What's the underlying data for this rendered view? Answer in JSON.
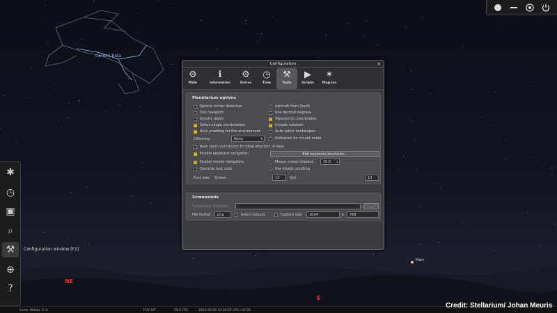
{
  "sky": {
    "constellation_label": "Gemini Beta",
    "planet_label": "Mars",
    "cardinals": {
      "ne": "NE",
      "e": "E"
    }
  },
  "tooltip": "Configuration window  [F2]",
  "credit": "Credit: Stellarium/ Johan Meuris",
  "statusbar": {
    "location": "Earth, Wikitti, 0 m",
    "fov": "FOV 60°",
    "fps": "55.9 FPS",
    "datetime": "2020-06-09 03:26:27 UTC+01:00"
  },
  "topbar": {
    "icons": [
      "moon-icon",
      "minimize-icon",
      "fullscreen-icon",
      "power-icon"
    ]
  },
  "lefttoolbar": {
    "items": [
      {
        "name": "sky-icon",
        "glyph": "✱"
      },
      {
        "name": "clock-icon",
        "glyph": "◷"
      },
      {
        "name": "sky-culture-icon",
        "glyph": "▣"
      },
      {
        "name": "search-icon",
        "glyph": "⌕"
      },
      {
        "name": "wrench-icon",
        "glyph": "⚒"
      },
      {
        "name": "compass-icon",
        "glyph": "⊕"
      },
      {
        "name": "help-icon",
        "glyph": "?"
      }
    ]
  },
  "config": {
    "title": "Configuration",
    "close": "×",
    "tabs": [
      {
        "label": "Main",
        "glyph": "⚙"
      },
      {
        "label": "Information",
        "glyph": "ℹ"
      },
      {
        "label": "Extras",
        "glyph": "⚙"
      },
      {
        "label": "Time",
        "glyph": "◷"
      },
      {
        "label": "Tools",
        "glyph": "⚒"
      },
      {
        "label": "Scripts",
        "glyph": "▶"
      },
      {
        "label": "Plug-ins",
        "glyph": "✶"
      }
    ],
    "planetarium": {
      "title": "Planetarium options",
      "left": [
        {
          "label": "Spheric mirror distortion",
          "checked": false
        },
        {
          "label": "Disc viewport",
          "checked": false
        },
        {
          "label": "Gravity labels",
          "checked": false
        },
        {
          "label": "Select single constellation",
          "checked": true
        },
        {
          "label": "Auto-enabling for the environment",
          "checked": true
        }
      ],
      "right": [
        {
          "label": "Azimuth from South",
          "checked": false
        },
        {
          "label": "Use decimal degrees",
          "checked": false
        },
        {
          "label": "Topocentric coordinates",
          "checked": true
        },
        {
          "label": "Include nutation",
          "checked": true
        },
        {
          "label": "Auto select landscapes",
          "checked": false
        },
        {
          "label": "Indication for mount mode",
          "checked": false
        }
      ],
      "dithering_label": "Dithering",
      "dithering_value": "None",
      "auto_zoom": "Auto zoom out returns to initial direction of view",
      "keyboard_nav": "Enable keyboard navigation",
      "edit_shortcuts": "Edit keyboard shortcuts...",
      "mouse_nav": "Enable mouse navigation",
      "mouse_timeout": "Mouse cursor timeout:",
      "mouse_timeout_value": "10.0",
      "override_text": "Override text color",
      "kinetic": "Use kinetic scrolling",
      "font_size_label": "Font size:",
      "font_size_screen": "Screen",
      "font_size_screen_value": "13",
      "font_size_gui": "GUI",
      "font_size_gui_value": "13"
    },
    "screenshots": {
      "title": "Screenshots",
      "directory_label": "Screenshot Directory",
      "browse": "...",
      "format_label": "File format",
      "format_value": "png",
      "invert": "Invert colours",
      "custom": "Custom size",
      "width": "1024",
      "x": "x",
      "height": "768"
    }
  }
}
